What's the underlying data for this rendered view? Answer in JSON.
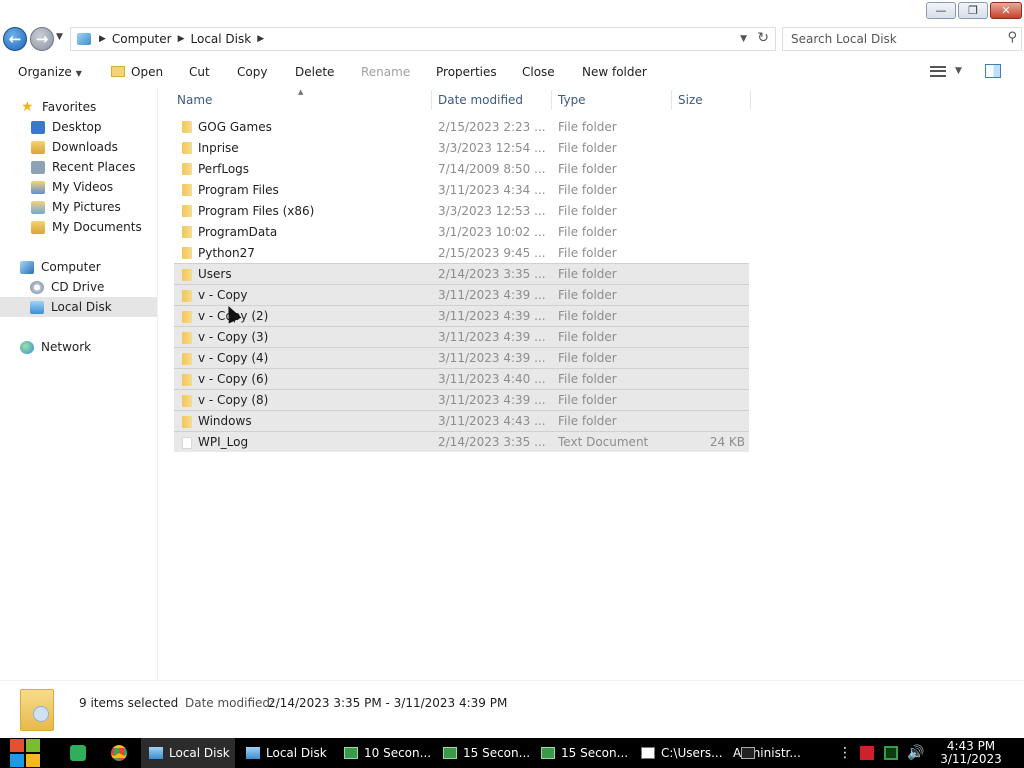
{
  "window": {
    "buttons": {
      "minimize": "—",
      "maximize": "❐",
      "close": "✕"
    }
  },
  "address": {
    "breadcrumbs": [
      "Computer",
      "Local Disk"
    ],
    "search_placeholder": "Search Local Disk"
  },
  "toolbar": {
    "organize": "Organize",
    "open": "Open",
    "cut": "Cut",
    "copy": "Copy",
    "delete": "Delete",
    "rename": "Rename",
    "properties": "Properties",
    "close": "Close",
    "new_folder": "New folder"
  },
  "sidebar": {
    "favorites": "Favorites",
    "favorite_items": [
      "Desktop",
      "Downloads",
      "Recent Places",
      "My Videos",
      "My Pictures",
      "My Documents"
    ],
    "computer": "Computer",
    "computer_items": [
      "CD Drive",
      "Local Disk"
    ],
    "network": "Network",
    "selected": "Local Disk"
  },
  "columns": {
    "name": "Name",
    "date": "Date modified",
    "type": "Type",
    "size": "Size"
  },
  "files": [
    {
      "name": "GOG Games",
      "date": "2/15/2023 2:23 ...",
      "type": "File folder",
      "size": "",
      "selected": false
    },
    {
      "name": "Inprise",
      "date": "3/3/2023 12:54 ...",
      "type": "File folder",
      "size": "",
      "selected": false
    },
    {
      "name": "PerfLogs",
      "date": "7/14/2009 8:50 ...",
      "type": "File folder",
      "size": "",
      "selected": false
    },
    {
      "name": "Program Files",
      "date": "3/11/2023 4:34 ...",
      "type": "File folder",
      "size": "",
      "selected": false
    },
    {
      "name": "Program Files (x86)",
      "date": "3/3/2023 12:53 ...",
      "type": "File folder",
      "size": "",
      "selected": false
    },
    {
      "name": "ProgramData",
      "date": "3/1/2023 10:02 ...",
      "type": "File folder",
      "size": "",
      "selected": false
    },
    {
      "name": "Python27",
      "date": "2/15/2023 9:45 ...",
      "type": "File folder",
      "size": "",
      "selected": false
    },
    {
      "name": "Users",
      "date": "2/14/2023 3:35 ...",
      "type": "File folder",
      "size": "",
      "selected": true
    },
    {
      "name": "v - Copy",
      "date": "3/11/2023 4:39 ...",
      "type": "File folder",
      "size": "",
      "selected": true
    },
    {
      "name": "v - Copy (2)",
      "date": "3/11/2023 4:39 ...",
      "type": "File folder",
      "size": "",
      "selected": true
    },
    {
      "name": "v - Copy (3)",
      "date": "3/11/2023 4:39 ...",
      "type": "File folder",
      "size": "",
      "selected": true
    },
    {
      "name": "v - Copy (4)",
      "date": "3/11/2023 4:39 ...",
      "type": "File folder",
      "size": "",
      "selected": true
    },
    {
      "name": "v - Copy (6)",
      "date": "3/11/2023 4:40 ...",
      "type": "File folder",
      "size": "",
      "selected": true
    },
    {
      "name": "v - Copy (8)",
      "date": "3/11/2023 4:39 ...",
      "type": "File folder",
      "size": "",
      "selected": true
    },
    {
      "name": "Windows",
      "date": "3/11/2023 4:43 ...",
      "type": "File folder",
      "size": "",
      "selected": true
    },
    {
      "name": "WPI_Log",
      "date": "2/14/2023 3:35 ...",
      "type": "Text Document",
      "size": "24 KB",
      "selected": true
    }
  ],
  "details": {
    "count": "9 items selected",
    "date_label": "Date modified:",
    "date_value": "2/14/2023 3:35 PM - 3/11/2023 4:39 PM"
  },
  "taskbar": {
    "buttons": [
      {
        "label": "Local Disk",
        "icon": "folder-icon",
        "active": true
      },
      {
        "label": "Local Disk",
        "icon": "folder-icon",
        "active": false
      },
      {
        "label": "10 Secon...",
        "icon": "screen-icon",
        "active": false
      },
      {
        "label": "15 Secon...",
        "icon": "screen-icon",
        "active": false
      },
      {
        "label": "15 Secon...",
        "icon": "screen-icon",
        "active": false
      },
      {
        "label": "C:\\Users...",
        "icon": "archive-icon",
        "active": false
      },
      {
        "label": "Administr...",
        "icon": "console-icon",
        "active": false
      }
    ],
    "time": "4:43 PM",
    "date": "3/11/2023"
  }
}
